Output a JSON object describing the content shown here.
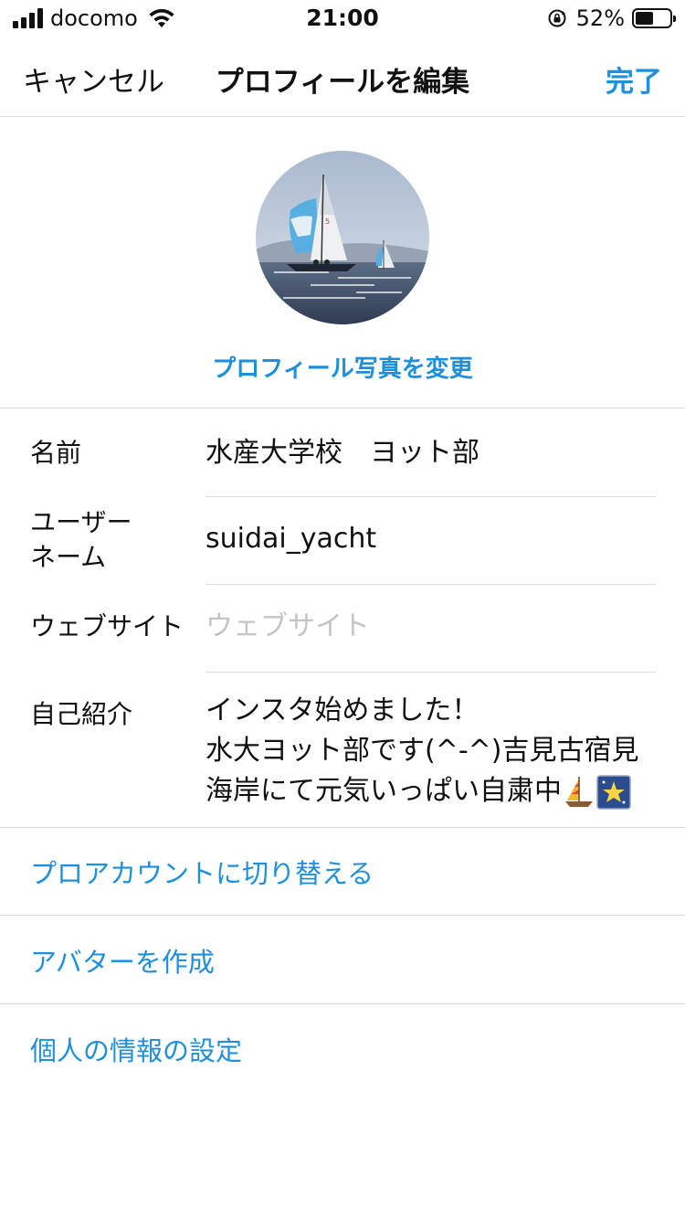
{
  "status_bar": {
    "carrier": "docomo",
    "time": "21:00",
    "battery_percent": "52%",
    "battery_level": 0.52
  },
  "nav": {
    "cancel_label": "キャンセル",
    "title": "プロフィールを編集",
    "done_label": "完了"
  },
  "avatar": {
    "change_label": "プロフィール写真を変更"
  },
  "form": {
    "name": {
      "label": "名前",
      "value": "水産大学校　ヨット部"
    },
    "username": {
      "label_line1": "ユーザー",
      "label_line2": "ネーム",
      "value": "suidai_yacht"
    },
    "website": {
      "label": "ウェブサイト",
      "placeholder": "ウェブサイト",
      "value": ""
    },
    "bio": {
      "label": "自己紹介",
      "line1": "インスタ始めました！",
      "line2": "水大ヨット部です(^-^)吉見古宿見",
      "line3": "海岸にて元気いっぱい自粛中"
    }
  },
  "links": {
    "pro_account": "プロアカウントに切り替える",
    "avatar": "アバターを作成",
    "personal_info": "個人の情報の設定"
  },
  "colors": {
    "accent": "#1e8fdc",
    "separator": "#dbdbdb",
    "placeholder": "#c4c4c4"
  }
}
